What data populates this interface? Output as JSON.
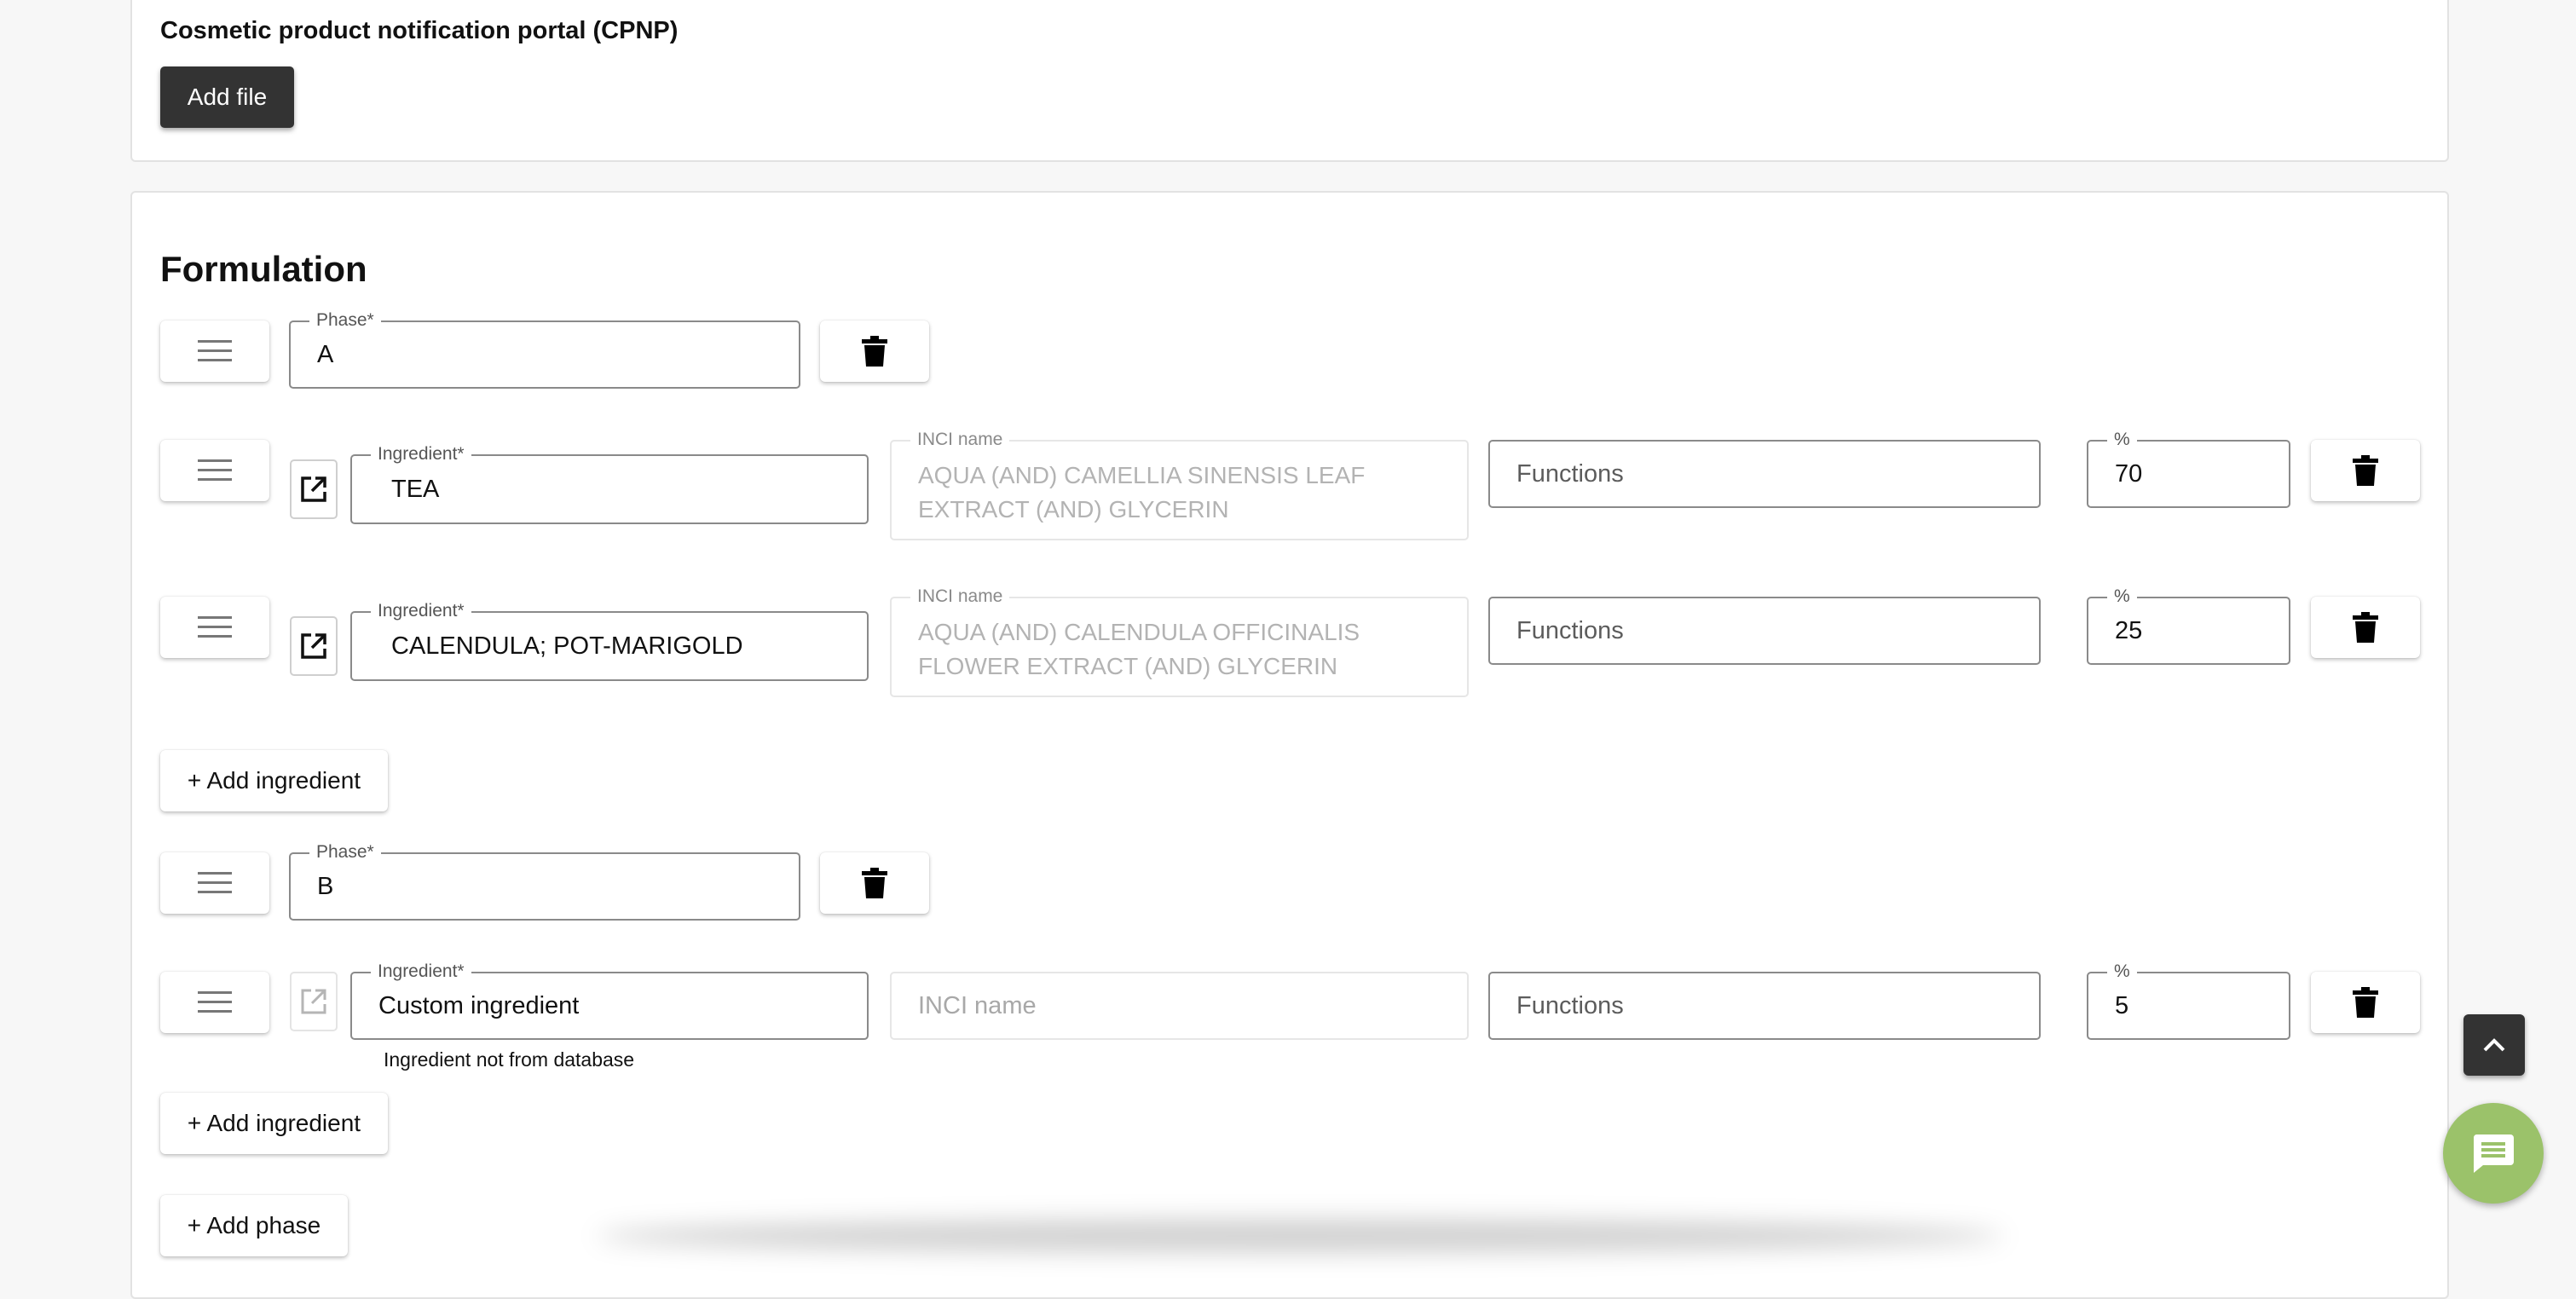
{
  "cpnp": {
    "title": "Cosmetic product notification portal (CPNP)",
    "add_file_label": "Add file"
  },
  "formulation": {
    "title": "Formulation",
    "phases": [
      {
        "phase_label": "Phase*",
        "phase_value": "A",
        "ingredients": [
          {
            "ingredient_label": "Ingredient*",
            "ingredient_value": "TEA",
            "inci_label": "INCI name",
            "inci_value": "AQUA (AND) CAMELLIA SINENSIS LEAF EXTRACT (AND) GLYCERIN",
            "functions_placeholder": "Functions",
            "percent_label": "%",
            "percent_value": "70"
          },
          {
            "ingredient_label": "Ingredient*",
            "ingredient_value": "CALENDULA; POT-MARIGOLD",
            "inci_label": "INCI name",
            "inci_value": "AQUA (AND) CALENDULA OFFICINALIS FLOWER EXTRACT (AND) GLYCERIN",
            "functions_placeholder": "Functions",
            "percent_label": "%",
            "percent_value": "25"
          }
        ],
        "add_ingredient_label": "+ Add ingredient"
      },
      {
        "phase_label": "Phase*",
        "phase_value": "B",
        "ingredients": [
          {
            "ingredient_label": "Ingredient*",
            "ingredient_value": "Custom ingredient",
            "inci_placeholder": "INCI name",
            "functions_placeholder": "Functions",
            "percent_label": "%",
            "percent_value": "5",
            "helper_text": "Ingredient not from database"
          }
        ],
        "add_ingredient_label": "+ Add ingredient"
      }
    ],
    "add_phase_label": "+ Add phase"
  },
  "icons": {
    "drag": "drag-handle-icon",
    "delete": "trash-icon",
    "open": "open-in-new-icon",
    "scroll_top": "chevron-up-icon",
    "chat": "chat-icon"
  },
  "colors": {
    "dark_button": "#333333",
    "chat_button": "#9bc26a"
  }
}
